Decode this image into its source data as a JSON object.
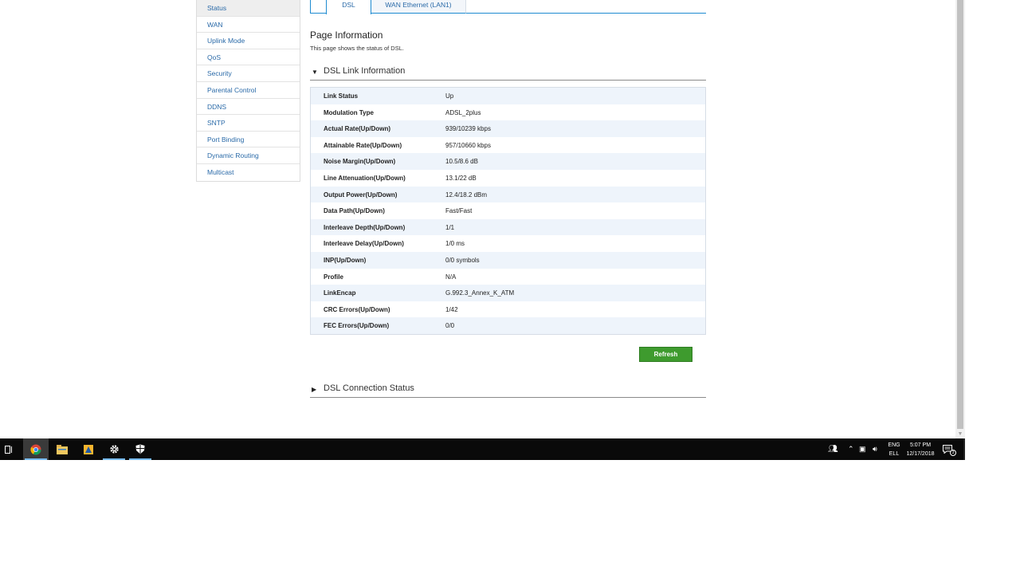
{
  "sidebar": {
    "items": [
      {
        "label": "Status"
      },
      {
        "label": "WAN"
      },
      {
        "label": "Uplink Mode"
      },
      {
        "label": "QoS"
      },
      {
        "label": "Security"
      },
      {
        "label": "Parental Control"
      },
      {
        "label": "DDNS"
      },
      {
        "label": "SNTP"
      },
      {
        "label": "Port Binding"
      },
      {
        "label": "Dynamic Routing"
      },
      {
        "label": "Multicast"
      }
    ]
  },
  "tabs": [
    {
      "label": "DSL"
    },
    {
      "label": "WAN Ethernet (LAN1)"
    }
  ],
  "page": {
    "title": "Page Information",
    "description": "This page shows the status of DSL."
  },
  "sections": {
    "link_info": {
      "label": "DSL Link Information",
      "arrow": "▼"
    },
    "connection_status": {
      "label": "DSL Connection Status",
      "arrow": "▶"
    }
  },
  "info_rows": [
    {
      "key": "Link Status",
      "value": "Up"
    },
    {
      "key": "Modulation Type",
      "value": "ADSL_2plus"
    },
    {
      "key": "Actual Rate(Up/Down)",
      "value": "939/10239 kbps"
    },
    {
      "key": "Attainable Rate(Up/Down)",
      "value": "957/10660 kbps"
    },
    {
      "key": "Noise Margin(Up/Down)",
      "value": "10.5/8.6 dB"
    },
    {
      "key": "Line Attenuation(Up/Down)",
      "value": "13.1/22 dB"
    },
    {
      "key": "Output Power(Up/Down)",
      "value": "12.4/18.2 dBm"
    },
    {
      "key": "Data Path(Up/Down)",
      "value": "Fast/Fast"
    },
    {
      "key": "Interleave Depth(Up/Down)",
      "value": "1/1"
    },
    {
      "key": "Interleave Delay(Up/Down)",
      "value": "1/0 ms"
    },
    {
      "key": "INP(Up/Down)",
      "value": "0/0 symbols"
    },
    {
      "key": "Profile",
      "value": "N/A"
    },
    {
      "key": "LinkEncap",
      "value": "G.992.3_Annex_K_ATM"
    },
    {
      "key": "CRC Errors(Up/Down)",
      "value": "1/42"
    },
    {
      "key": "FEC Errors(Up/Down)",
      "value": "0/0"
    }
  ],
  "buttons": {
    "refresh": "Refresh"
  },
  "taskbar": {
    "icons": [
      "task-view-icon",
      "chrome-icon",
      "file-explorer-icon",
      "app-icon",
      "settings-icon",
      "windows-defender-icon"
    ],
    "lang_top": "ENG",
    "lang_bottom": "ELL",
    "time": "5:07 PM",
    "date": "12/17/2018",
    "notification_count": "3"
  }
}
